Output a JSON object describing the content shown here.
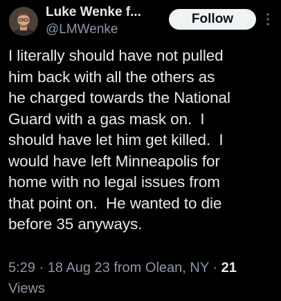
{
  "author": {
    "display_name": "Luke Wenke f...",
    "handle": "@LMWenke",
    "avatar_icon": "profile-photo"
  },
  "actions": {
    "follow_label": "Follow",
    "more_icon": "vertical-ellipsis-icon"
  },
  "tweet": {
    "text": "I literally should have not pulled\nhim back with all the others as\nhe charged towards the National\nGuard with a gas mask on.  I\nshould have let him get killed.  I\nwould have left Minneapolis for\nhome with no legal issues from\nthat point on.  He wanted to die\nbefore 35 anyways."
  },
  "meta": {
    "time_date_location": "5:29 · 18 Aug 23 from Olean, NY · ",
    "views_count": "21",
    "views_label": "Views"
  },
  "colors": {
    "background": "#000000",
    "primary_text": "#e7e9ea",
    "secondary_text": "#8b98a5",
    "follow_button_bg": "#eff3f4"
  }
}
